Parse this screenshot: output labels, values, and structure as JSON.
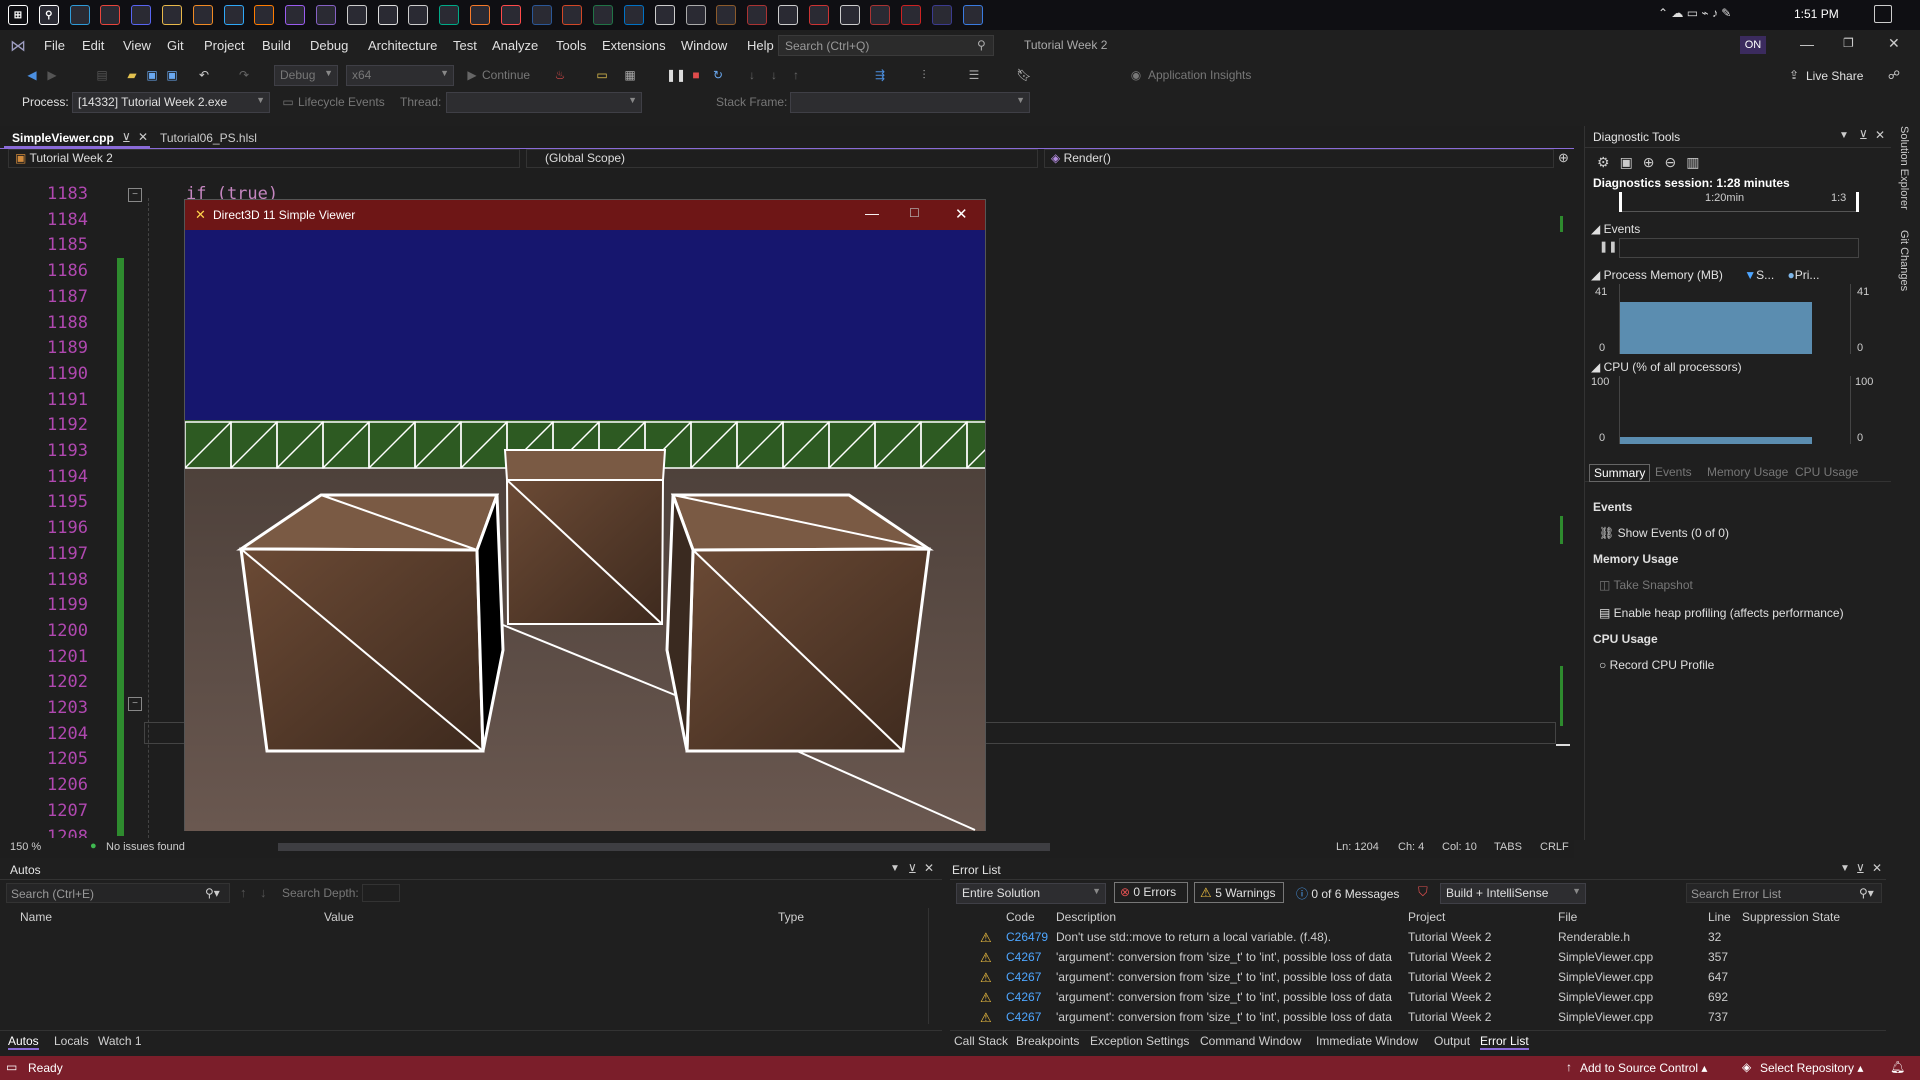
{
  "taskbar": {
    "clock": "1:51 PM",
    "app_icons": [
      "start-icon",
      "search-icon",
      "edge-icon",
      "chrome-icon",
      "discord-icon",
      "file-explorer-icon",
      "flstudio-icon",
      "photoshop-icon",
      "illustrator-icon",
      "aftereffects-icon",
      "visual-studio-icon",
      "capcut-icon",
      "unreal-icon",
      "unity-icon",
      "maya-icon",
      "blender-icon",
      "itch-icon",
      "word-icon",
      "powerpoint-icon",
      "excel-icon",
      "outlook-icon",
      "github-icon",
      "notes-icon",
      "minecraft-icon",
      "game-icon",
      "game2-icon",
      "game3-icon",
      "game4-icon",
      "game5-icon",
      "app6-icon",
      "app7-icon",
      "app8-icon"
    ]
  },
  "menubar": {
    "items": [
      "File",
      "Edit",
      "View",
      "Git",
      "Project",
      "Build",
      "Debug",
      "Architecture",
      "Test",
      "Analyze",
      "Tools",
      "Extensions",
      "Window",
      "Help"
    ],
    "search_placeholder": "Search (Ctrl+Q)",
    "solution_name": "Tutorial Week 2",
    "user_badge": "ON"
  },
  "toolbar": {
    "config": "Debug",
    "platform": "x64",
    "continue_label": "Continue",
    "app_insights": "Application Insights",
    "live_share": "Live Share",
    "process_label": "Process:",
    "process_value": "[14332] Tutorial Week 2.exe",
    "lifecycle_label": "Lifecycle Events",
    "thread_label": "Thread:",
    "stack_frame_label": "Stack Frame:"
  },
  "editor": {
    "tabs": [
      {
        "label": "SimpleViewer.cpp",
        "active": true
      },
      {
        "label": "Tutorial06_PS.hlsl",
        "active": false
      }
    ],
    "nav_project": "Tutorial Week 2",
    "nav_scope": "(Global Scope)",
    "nav_member": "Render()",
    "code_line": "if (true)",
    "line_numbers": [
      "1183",
      "1184",
      "1185",
      "1186",
      "1187",
      "1188",
      "1189",
      "1190",
      "1191",
      "1192",
      "1193",
      "1194",
      "1195",
      "1196",
      "1197",
      "1198",
      "1199",
      "1200",
      "1201",
      "1202",
      "1203",
      "1204",
      "1205",
      "1206",
      "1207",
      "1208"
    ],
    "zoom": "150 %",
    "issues": "No issues found",
    "ln": "Ln: 1204",
    "ch": "Ch: 4",
    "col": "Col: 10",
    "tabs_mode": "TABS",
    "eol": "CRLF"
  },
  "dx_window": {
    "title": "Direct3D 11 Simple Viewer",
    "sky_color": "#16166e",
    "ground_color": "#57473e",
    "crate_color": "#5a3e2c"
  },
  "diagnostics": {
    "title": "Diagnostic Tools",
    "session": "Diagnostics session: 1:28 minutes",
    "timeline_label": "1:20min",
    "timeline_label2": "1:3",
    "events_label": "Events",
    "process_memory": "Process Memory (MB)",
    "legend_s": "S...",
    "legend_pri": "Pri...",
    "mem_max_left": "41",
    "mem_min_left": "0",
    "mem_max_right": "41",
    "mem_min_right": "0",
    "cpu_label": "CPU (% of all processors)",
    "cpu_max_left": "100",
    "cpu_min_left": "0",
    "cpu_max_right": "100",
    "cpu_min_right": "0",
    "tabs": [
      "Summary",
      "Events",
      "Memory Usage",
      "CPU Usage"
    ],
    "events_heading": "Events",
    "show_events": "Show Events (0 of 0)",
    "memory_heading": "Memory Usage",
    "take_snapshot": "Take Snapshot",
    "heap_profiling": "Enable heap profiling (affects performance)",
    "cpu_heading": "CPU Usage",
    "record_cpu": "Record CPU Profile",
    "side_tabs": [
      "Solution Explorer",
      "Git Changes"
    ]
  },
  "autos": {
    "title": "Autos",
    "search_placeholder": "Search (Ctrl+E)",
    "search_depth": "Search Depth:",
    "columns": [
      "Name",
      "Value",
      "Type"
    ],
    "tabs": [
      "Autos",
      "Locals",
      "Watch 1"
    ]
  },
  "error_list": {
    "title": "Error List",
    "scope": "Entire Solution",
    "errors": "0 Errors",
    "warnings": "5 Warnings",
    "messages": "0 of 6 Messages",
    "build_filter": "Build + IntelliSense",
    "search_placeholder": "Search Error List",
    "columns": [
      "Code",
      "Description",
      "Project",
      "File",
      "Line",
      "Suppression State"
    ],
    "rows": [
      {
        "code": "C26479",
        "description": "Don't use std::move to return a local variable. (f.48).",
        "project": "Tutorial Week 2",
        "file": "Renderable.h",
        "line": "32"
      },
      {
        "code": "C4267",
        "description": "'argument': conversion from 'size_t' to 'int', possible loss of data",
        "project": "Tutorial Week 2",
        "file": "SimpleViewer.cpp",
        "line": "357"
      },
      {
        "code": "C4267",
        "description": "'argument': conversion from 'size_t' to 'int', possible loss of data",
        "project": "Tutorial Week 2",
        "file": "SimpleViewer.cpp",
        "line": "647"
      },
      {
        "code": "C4267",
        "description": "'argument': conversion from 'size_t' to 'int', possible loss of data",
        "project": "Tutorial Week 2",
        "file": "SimpleViewer.cpp",
        "line": "692"
      },
      {
        "code": "C4267",
        "description": "'argument': conversion from 'size_t' to 'int', possible loss of data",
        "project": "Tutorial Week 2",
        "file": "SimpleViewer.cpp",
        "line": "737"
      }
    ],
    "tabs": [
      "Call Stack",
      "Breakpoints",
      "Exception Settings",
      "Command Window",
      "Immediate Window",
      "Output",
      "Error List"
    ]
  },
  "statusbar": {
    "ready": "Ready",
    "source_control": "Add to Source Control",
    "repository": "Select Repository"
  }
}
